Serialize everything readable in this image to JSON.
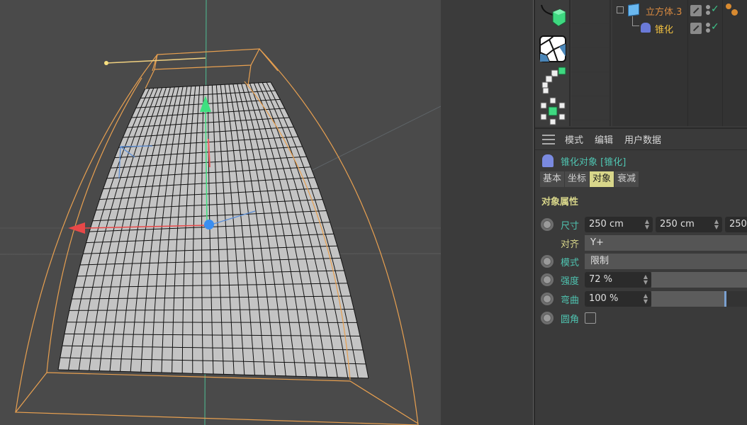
{
  "viewport": {
    "bg_color": "#4a4a4a",
    "wire_color": "#e8a050",
    "mesh_color": "#c4c4c4",
    "axis_x_color": "#e84848",
    "axis_y_color": "#3ee080",
    "axis_z_color": "#3a8ef0"
  },
  "object_palette": {
    "icons": [
      "spline-cube-icon",
      "voronoi-fracture-icon",
      "cloner-array-icon",
      "cloner-radial-icon"
    ]
  },
  "object_manager": {
    "objects": [
      {
        "name": "立方体.3",
        "color": "#d88a40",
        "icon": "cube-icon",
        "edit": "edit-tag",
        "visible": true,
        "tag": "material-spheres-icon"
      },
      {
        "name": "锥化",
        "color": "#f0c040",
        "icon": "taper-icon",
        "edit": "edit-tag",
        "visible": true
      }
    ]
  },
  "attributes": {
    "menu": [
      "模式",
      "编辑",
      "用户数据"
    ],
    "title": "锥化对象 [锥化]",
    "tabs": [
      {
        "label": "基本",
        "active": false
      },
      {
        "label": "坐标",
        "active": false
      },
      {
        "label": "对象",
        "active": true
      },
      {
        "label": "衰减",
        "active": false
      }
    ],
    "section": "对象属性",
    "props": {
      "size": {
        "label": "尺寸",
        "x": "250 cm",
        "y": "250 cm",
        "z": "250"
      },
      "align": {
        "label": "对齐",
        "value": "Y+"
      },
      "mode": {
        "label": "模式",
        "value": "限制"
      },
      "strength": {
        "label": "强度",
        "value": "72 %",
        "fraction": 0.72
      },
      "curvature": {
        "label": "弯曲",
        "value": "100 %",
        "fraction": 1.0
      },
      "fillet": {
        "label": "圆角",
        "checked": false
      }
    }
  }
}
